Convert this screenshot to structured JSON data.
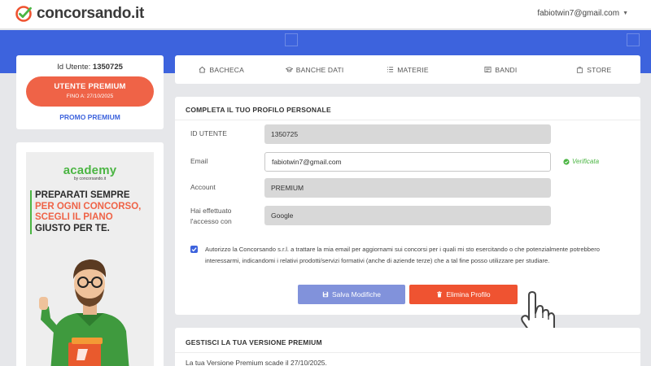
{
  "header": {
    "logo_text": "concorsando.it",
    "user_email": "fabiotwin7@gmail.com"
  },
  "user_card": {
    "id_label": "Id Utente:",
    "id_value": "1350725",
    "premium_title": "UTENTE PREMIUM",
    "premium_until": "FINO A: 27/10/2025",
    "promo_link": "PROMO PREMIUM"
  },
  "ad": {
    "logo_main": "academy",
    "logo_sub": "by concorsando.it",
    "line1": "PREPARATI SEMPRE",
    "line2": "PER OGNI CONCORSO,",
    "line3": "SCEGLI IL PIANO",
    "line4": "GIUSTO PER TE."
  },
  "nav": {
    "items": [
      {
        "label": "BACHECA",
        "icon": "home-icon"
      },
      {
        "label": "BANCHE DATI",
        "icon": "graduation-cap-icon"
      },
      {
        "label": "MATERIE",
        "icon": "list-icon"
      },
      {
        "label": "BANDI",
        "icon": "newspaper-icon"
      },
      {
        "label": "STORE",
        "icon": "shopping-bag-icon"
      }
    ]
  },
  "profile": {
    "title": "COMPLETA IL TUO PROFILO PERSONALE",
    "id_label": "ID UTENTE",
    "id_value": "1350725",
    "email_label": "Email",
    "email_value": "fabiotwin7@gmail.com",
    "verified_label": "Verificata",
    "account_label": "Account",
    "account_value": "PREMIUM",
    "access_label_1": "Hai effettuato",
    "access_label_2": "l'accesso con",
    "access_value": "Google",
    "consent_text": "Autorizzo la Concorsando s.r.l. a trattare la mia email per aggiornami sui concorsi per i quali mi sto esercitando o che potenzialmente potrebbero interessarmi, indicandomi i relativi prodotti/servizi formativi (anche di aziende terze) che a tal fine posso utilizzare per studiare.",
    "consent_checked": true,
    "save_label": "Salva Modifiche",
    "delete_label": "Elimina Profilo"
  },
  "premium_section": {
    "title": "GESTISCI LA TUA VERSIONE PREMIUM",
    "text": "La tua Versione Premium scade il 27/10/2025."
  },
  "colors": {
    "brand_blue": "#3d63dd",
    "accent_coral": "#ef6347",
    "delete_red": "#ef5331",
    "success_green": "#4bb543"
  }
}
